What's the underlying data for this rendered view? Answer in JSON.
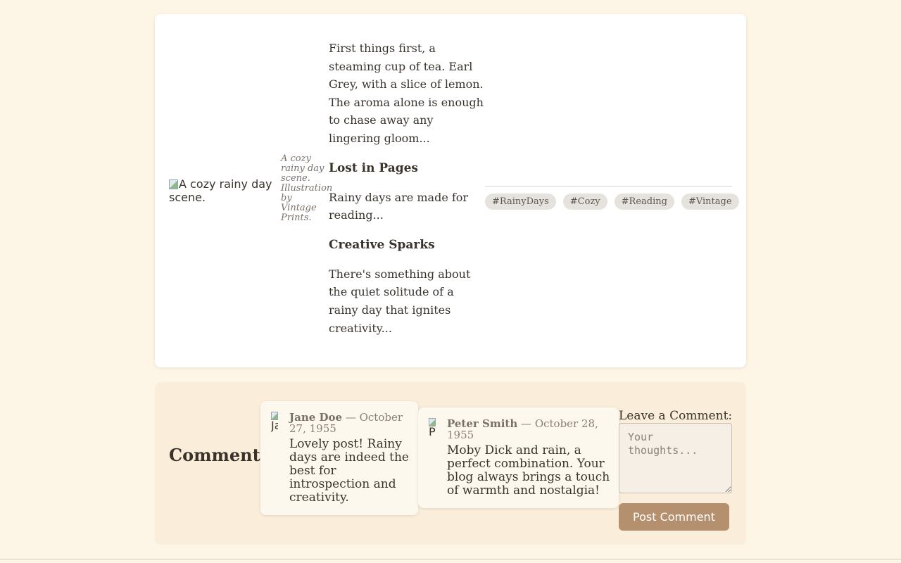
{
  "article": {
    "image_alt": "A cozy rainy day scene.",
    "figcaption": "A cozy rainy day scene. Illustration by Vintage Prints.",
    "paragraph_tea": "First things first, a steaming cup of tea. Earl Grey, with a slice of lemon. The aroma alone is enough to chase away any lingering gloom...",
    "heading_lost": "Lost in Pages",
    "paragraph_reading": "Rainy days are made for reading...",
    "heading_creative": "Creative Sparks",
    "paragraph_creative": "There's something about the quiet solitude of a rainy day that ignites creativity..."
  },
  "tags": [
    "#RainyDays",
    "#Cozy",
    "#Reading",
    "#Vintage"
  ],
  "comments": {
    "title": "Comments",
    "items": [
      {
        "avatar_alt": "Ja",
        "author": "Jane Doe",
        "date": "— October 27, 1955",
        "text": "Lovely post! Rainy days are indeed the best for introspection and creativity."
      },
      {
        "avatar_alt": "P",
        "author": "Peter Smith",
        "date": "— October 28, 1955",
        "text": "Moby Dick and rain, a perfect combination. Your blog always brings a touch of warmth and nostalgia!"
      }
    ],
    "form": {
      "label": "Leave a Comment:",
      "placeholder": "Your thoughts...",
      "button": "Post Comment"
    }
  },
  "colors": {
    "page_background": "#fdf5e6",
    "card_background": "#ffffff",
    "comments_background": "#faeedb",
    "button_accent": "#b5906f",
    "tag_background": "#e6e3df"
  }
}
